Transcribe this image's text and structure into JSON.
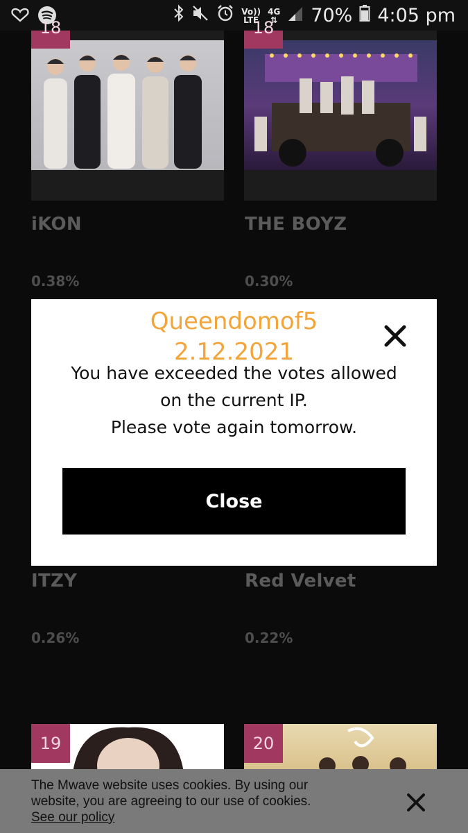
{
  "status_bar": {
    "battery": "70%",
    "time": "4:05 pm",
    "volte_label_top": "Vo))",
    "volte_label_bottom": "LTE",
    "network_label": "4G"
  },
  "cards": [
    {
      "rank": "18",
      "name": "iKON",
      "percent": "0.38%"
    },
    {
      "rank": "18",
      "name": "THE BOYZ",
      "percent": "0.30%"
    },
    {
      "name": "ITZY",
      "percent": "0.26%"
    },
    {
      "name": "Red Velvet",
      "percent": "0.22%"
    },
    {
      "rank": "19"
    },
    {
      "rank": "20"
    }
  ],
  "modal": {
    "title_line1": "Queendomof5",
    "title_line2": "2.12.2021",
    "message_line1": "You have exceeded the votes allowed",
    "message_line2": "on the current IP.",
    "message_line3": "Please vote again tomorrow.",
    "close_label": "Close"
  },
  "cookie_banner": {
    "text": "The Mwave website uses cookies. By using our website, you are agreeing to our use of cookies.",
    "link_text": "See our policy"
  },
  "colors": {
    "accent_orange": "#f2a53a",
    "rank_badge": "#a0385f",
    "background": "#0b0b0b"
  }
}
